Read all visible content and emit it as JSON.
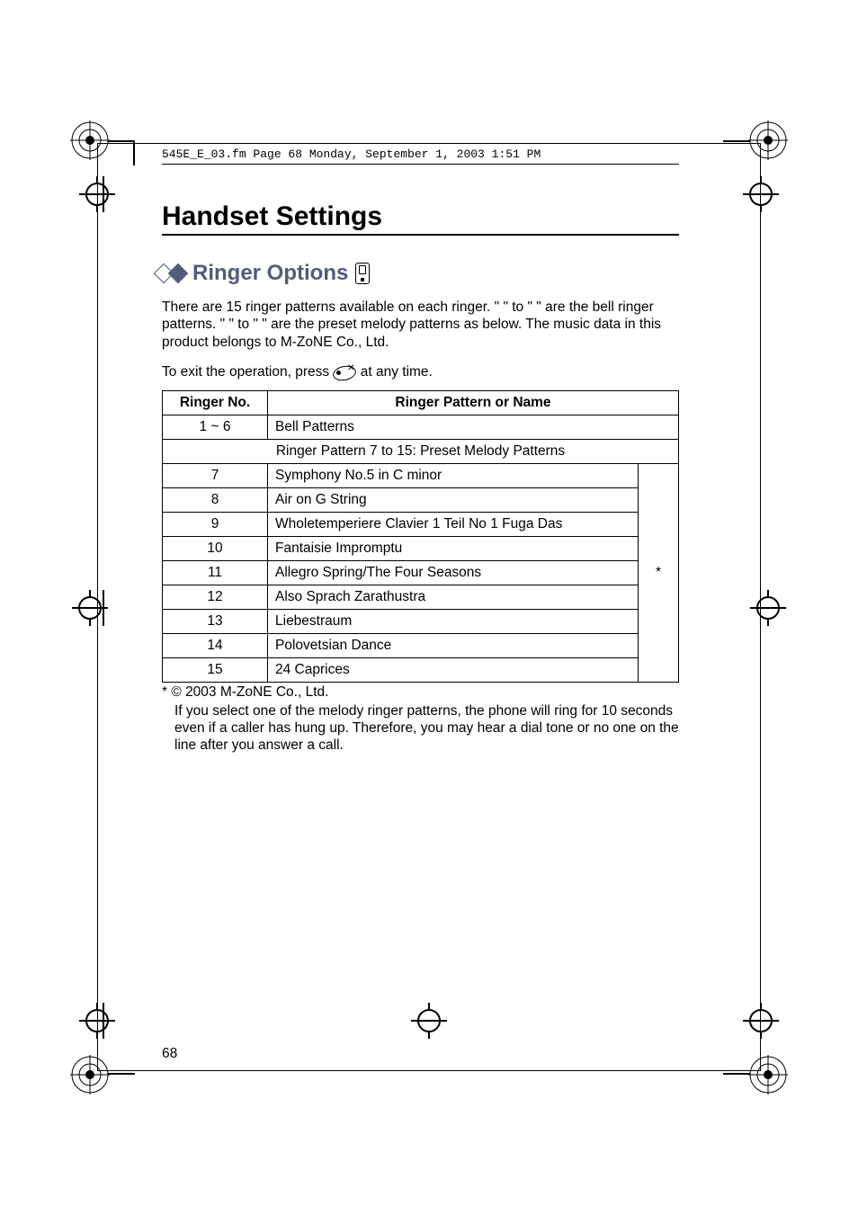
{
  "header_line": "545E_E_03.fm  Page 68  Monday, September 1, 2003  1:51 PM",
  "section_title": "Handset Settings",
  "sub_title": "Ringer Options",
  "intro_p1": "There are 15 ringer patterns available on each ringer. \"            \" to \"            \" are the bell ringer patterns. \"            \" to \"            \" are the preset melody patterns as below. The music data in this product belongs to M-ZoNE Co., Ltd.",
  "intro_p2_a": "To exit the operation, press ",
  "intro_p2_b": " at any time.",
  "table": {
    "head_no": "Ringer No.",
    "head_name": "Ringer Pattern or Name",
    "row_range": "1 ~ 6",
    "row_range_label": "Bell Patterns",
    "span_label": "Ringer Pattern 7 to 15: Preset Melody Patterns",
    "rows": [
      {
        "no": "7",
        "name": "Symphony No.5 in C minor"
      },
      {
        "no": "8",
        "name": "Air on G String"
      },
      {
        "no": "9",
        "name": "Wholetemperiere Clavier 1 Teil No 1 Fuga Das"
      },
      {
        "no": "10",
        "name": "Fantaisie Impromptu"
      },
      {
        "no": "11",
        "name": "Allegro Spring/The Four Seasons"
      },
      {
        "no": "12",
        "name": "Also Sprach Zarathustra"
      },
      {
        "no": "13",
        "name": "Liebestraum"
      },
      {
        "no": "14",
        "name": "Polovetsian Dance"
      },
      {
        "no": "15",
        "name": "24 Caprices"
      }
    ],
    "star": "*"
  },
  "footnote_line1": "* © 2003 M-ZoNE Co., Ltd.",
  "footnote_line2": "If you select one of the melody ringer patterns, the phone will ring for 10 seconds even if a caller has hung up. Therefore, you may hear a dial tone or no one on the line after you answer a call.",
  "page_number": "68"
}
